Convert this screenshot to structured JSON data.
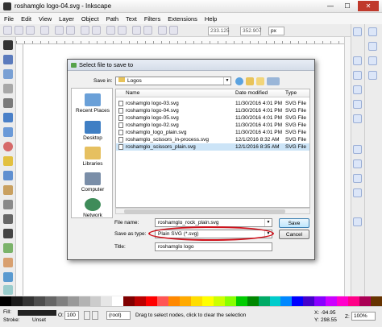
{
  "window": {
    "title": "roshamglo logo-04.svg - Inkscape",
    "min": "—",
    "max": "☐",
    "close": "✕"
  },
  "menu": [
    "File",
    "Edit",
    "View",
    "Layer",
    "Object",
    "Path",
    "Text",
    "Filters",
    "Extensions",
    "Help"
  ],
  "commands": {
    "x_value": "233.125",
    "y_value": "352.907",
    "unit": "px"
  },
  "dialog": {
    "title": "Select file to save to",
    "save_in_label": "Save in:",
    "save_in_value": "Logos",
    "places": [
      "Recent Places",
      "Desktop",
      "Libraries",
      "Computer",
      "Network"
    ],
    "columns": [
      "Name",
      "Date modified",
      "Type"
    ],
    "files": [
      {
        "name": "roshamglo logo-03.svg",
        "date": "11/30/2016 4:01 PM",
        "type": "SVG File"
      },
      {
        "name": "roshamglo logo-04.svg",
        "date": "11/30/2016 4:01 PM",
        "type": "SVG File"
      },
      {
        "name": "roshamglo logo-05.svg",
        "date": "11/30/2016 4:01 PM",
        "type": "SVG File"
      },
      {
        "name": "roshamglo logo-02.svg",
        "date": "11/30/2016 4:01 PM",
        "type": "SVG File"
      },
      {
        "name": "roshamglo_logo_plain.svg",
        "date": "11/30/2016 4:01 PM",
        "type": "SVG File"
      },
      {
        "name": "roshamglo_scissors_in-process.svg",
        "date": "12/1/2016 8:32 AM",
        "type": "SVG File"
      },
      {
        "name": "roshamglo_scissors_plain.svg",
        "date": "12/1/2016 8:35 AM",
        "type": "SVG File"
      }
    ],
    "file_name_label": "File name:",
    "file_name_value": "roshamglo_rock_plain.svg",
    "save_as_type_label": "Save as type:",
    "save_as_type_value": "Plain SVG (*.svg)",
    "title_label": "Title:",
    "title_value": "roshamglo logo",
    "save_button": "Save",
    "cancel_button": "Cancel"
  },
  "status": {
    "fill_label": "Fill:",
    "stroke_label": "Stroke:",
    "stroke_value": "Unset",
    "opacity_label": "O:",
    "opacity_value": "100",
    "layer_value": "(root)",
    "message": "Drag to select nodes, click to clear the selection",
    "x_label": "X:",
    "x_value": "-94.95",
    "y_label": "Y:",
    "y_value": "298.55",
    "zoom_label": "Z:",
    "zoom_value": "100%"
  },
  "colors": {
    "accent_red": "#d0101a",
    "selection": "#cce4f7",
    "toolbar_blue": "#dce6f8"
  }
}
